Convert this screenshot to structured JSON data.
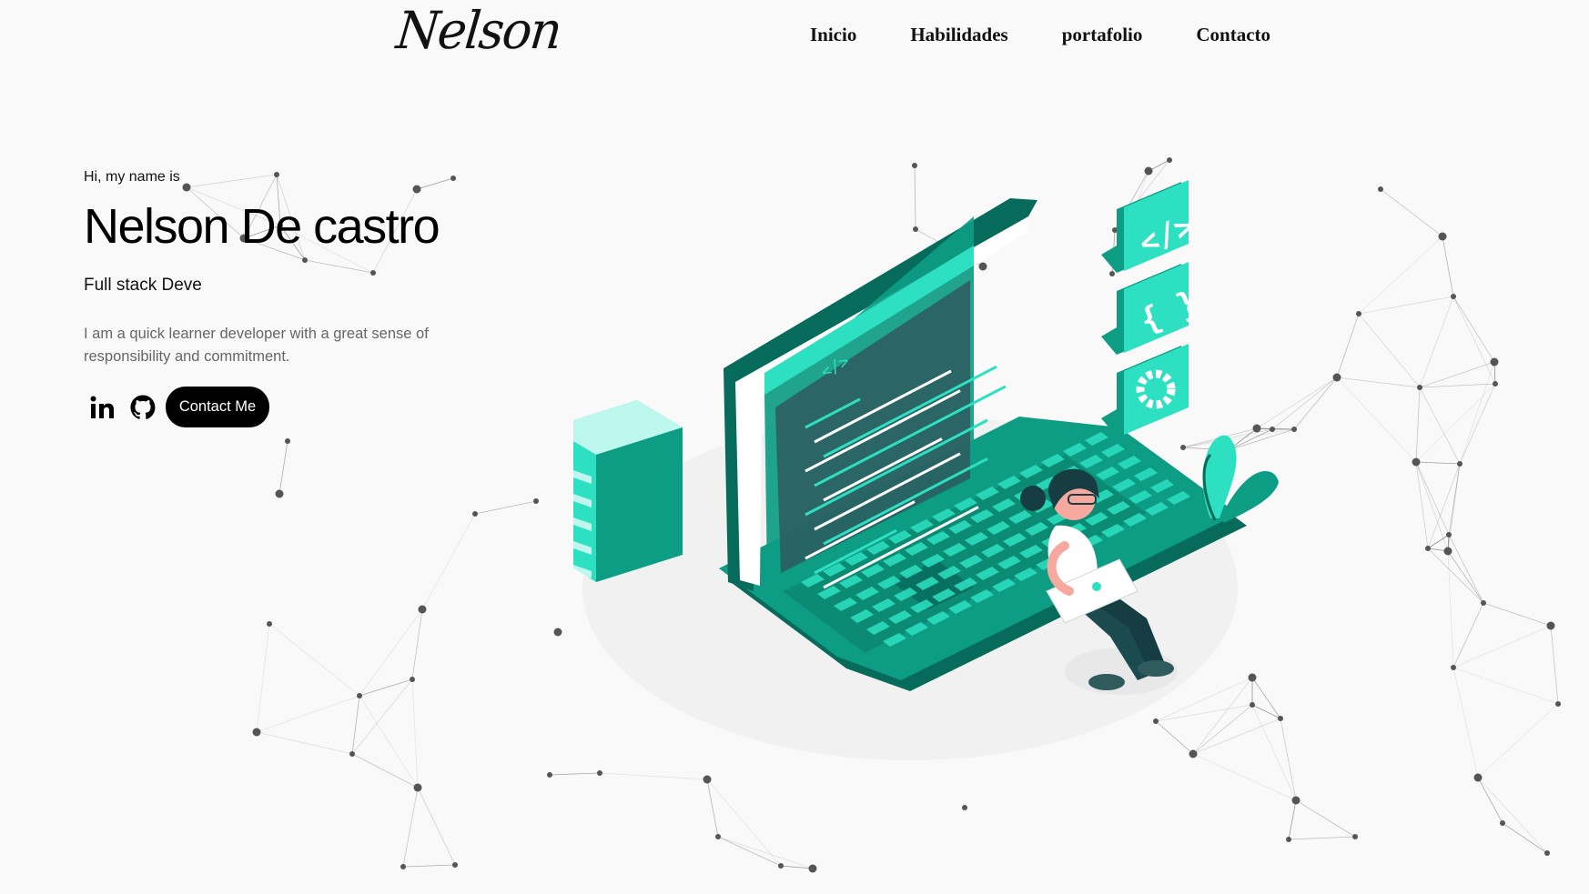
{
  "header": {
    "logo": "Nelson",
    "nav": [
      {
        "label": "Inicio"
      },
      {
        "label": "Habilidades"
      },
      {
        "label": "portafolio"
      },
      {
        "label": "Contacto"
      }
    ]
  },
  "hero": {
    "greeting": "Hi, my name is",
    "name": "Nelson De castro",
    "role": "Full stack Deve",
    "bio": "I am a quick learner developer with a great sense of responsibility and commitment.",
    "socials": [
      {
        "icon": "linkedin-icon"
      },
      {
        "icon": "github-icon"
      }
    ],
    "cta_label": "Contact Me"
  },
  "illustration": {
    "code_tag": "</>",
    "braces": "{ }",
    "icons": [
      "code-icon",
      "braces-icon",
      "gear-icon"
    ]
  },
  "colors": {
    "background": "#f9f9f9",
    "accent": "#0d9c84",
    "accent_light": "#2de0c2",
    "accent_dark": "#066b5a",
    "text": "#111111",
    "muted": "#666666"
  }
}
